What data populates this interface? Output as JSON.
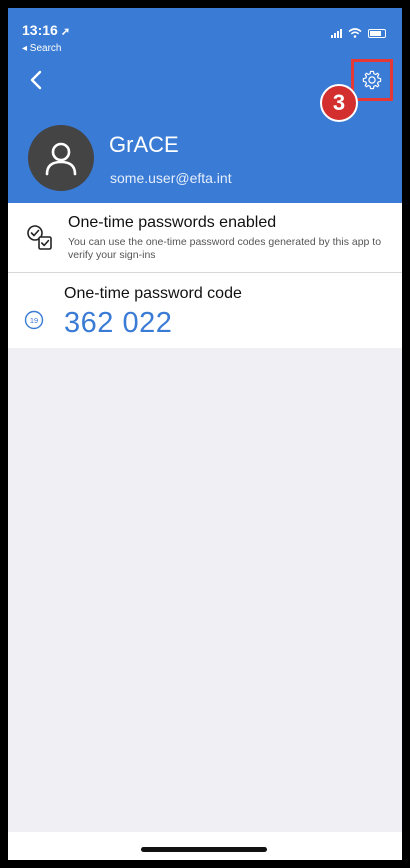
{
  "status_bar": {
    "time": "13:16",
    "location_icon": "location-arrow-icon",
    "back_app_label": "◂ Search",
    "signal_icon": "cellular-signal-icon",
    "wifi_icon": "wifi-icon",
    "battery_icon": "battery-icon"
  },
  "header": {
    "back_icon": "chevron-left-icon",
    "settings_icon": "gear-icon",
    "step_marker": "3",
    "highlight_color": "#e53935",
    "background_color": "#3a7bd5"
  },
  "account": {
    "avatar_icon": "person-icon",
    "name": "GrACE",
    "email": "some.user@efta.int"
  },
  "otp_status": {
    "icon": "checkbox-pair-icon",
    "title": "One-time passwords enabled",
    "description": "You can use the one-time password codes generated by this app to verify your sign-ins"
  },
  "otp_code": {
    "timer_icon": "countdown-timer-icon",
    "seconds_remaining": "19",
    "title": "One-time password code",
    "code": "362 022"
  }
}
